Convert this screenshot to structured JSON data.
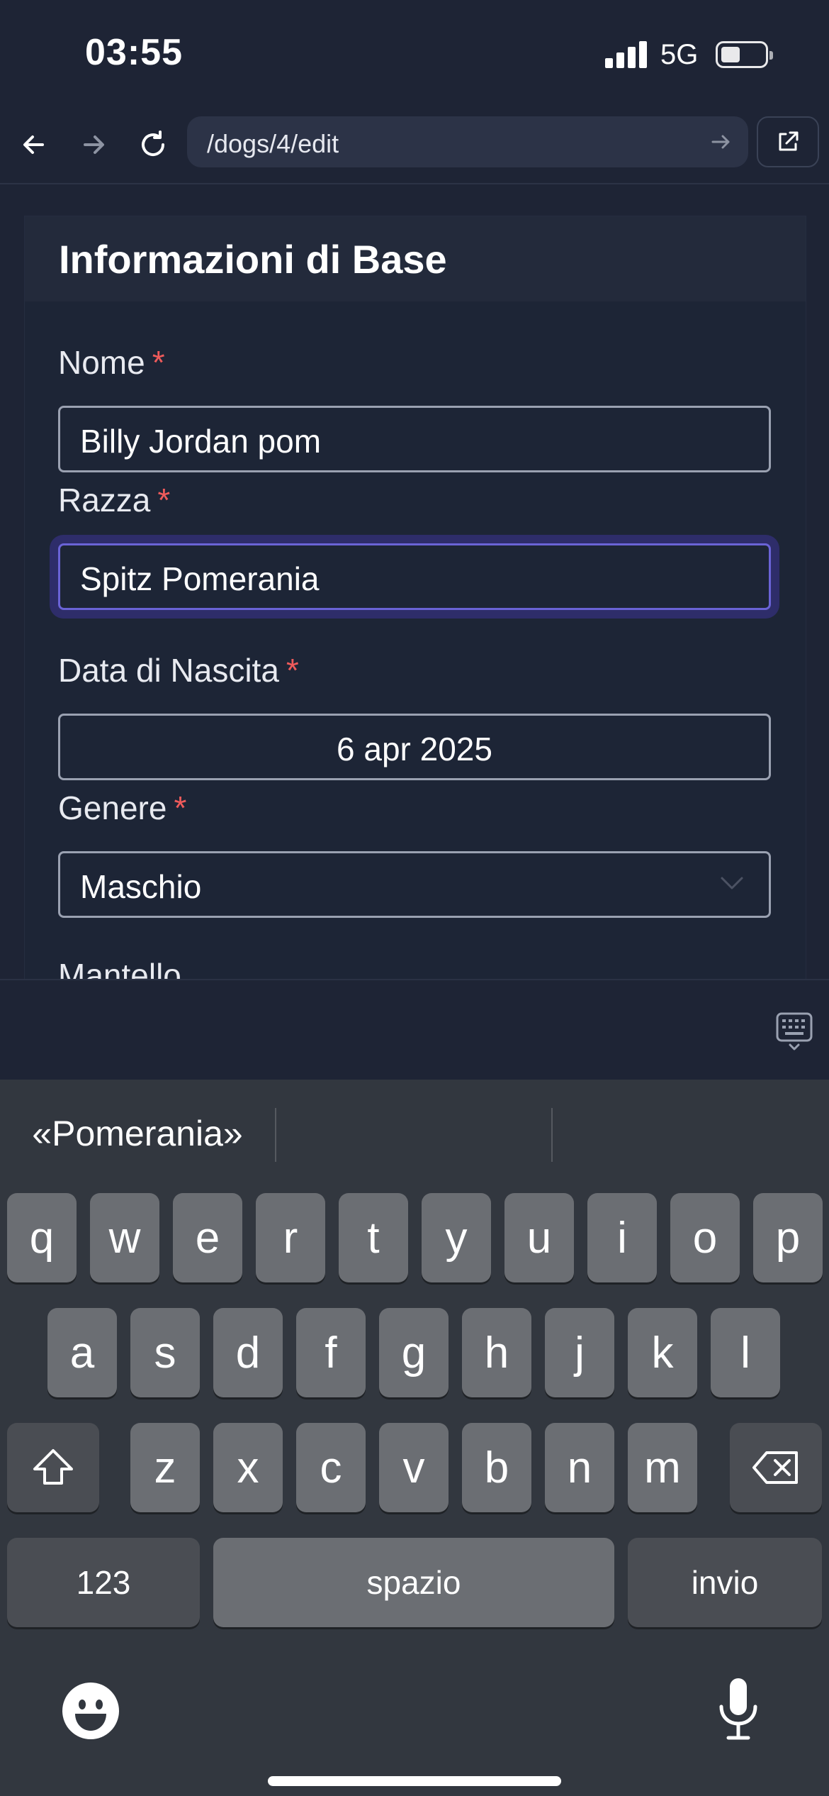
{
  "status": {
    "time": "03:55",
    "network": "5G"
  },
  "browser": {
    "url": "/dogs/4/edit"
  },
  "card": {
    "title": "Informazioni di Base"
  },
  "form": {
    "nome": {
      "label": "Nome",
      "value": "Billy Jordan pom"
    },
    "razza": {
      "label": "Razza",
      "value": "Spitz Pomerania"
    },
    "nascita": {
      "label": "Data di Nascita",
      "value": "6 apr 2025"
    },
    "genere": {
      "label": "Genere",
      "value": "Maschio"
    },
    "mantello": {
      "label": "Mantello"
    },
    "required_mark": "*"
  },
  "keyboard": {
    "suggestions": [
      "«Pomerania»",
      "",
      ""
    ],
    "row1": [
      "q",
      "w",
      "e",
      "r",
      "t",
      "y",
      "u",
      "i",
      "o",
      "p"
    ],
    "row2": [
      "a",
      "s",
      "d",
      "f",
      "g",
      "h",
      "j",
      "k",
      "l"
    ],
    "row3": [
      "z",
      "x",
      "c",
      "v",
      "b",
      "n",
      "m"
    ],
    "numbers_label": "123",
    "space_label": "spazio",
    "return_label": "invio"
  },
  "colors": {
    "accent": "#6a63d6",
    "required": "#ef5b5b",
    "background": "#1e2435"
  }
}
